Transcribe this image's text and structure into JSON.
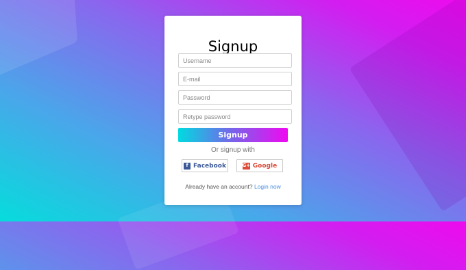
{
  "card": {
    "title": "Signup",
    "fields": {
      "username_placeholder": "Username",
      "email_placeholder": "E-mail",
      "password_placeholder": "Password",
      "retype_placeholder": "Retype password"
    },
    "signup_button": "Signup",
    "or_text": "Or signup with",
    "social": {
      "facebook_label": "Facebook",
      "google_label": "Google",
      "facebook_icon": "f",
      "google_icon": "G+"
    },
    "login_prompt": "Already have an account?",
    "login_link": "Login now"
  },
  "colors": {
    "gradient_start": "#06dcdc",
    "gradient_end": "#ee0aee",
    "facebook": "#3b5998",
    "google": "#dd4b39",
    "link": "#4a8fe0"
  },
  "icons": [
    "facebook-icon",
    "google-plus-icon"
  ]
}
